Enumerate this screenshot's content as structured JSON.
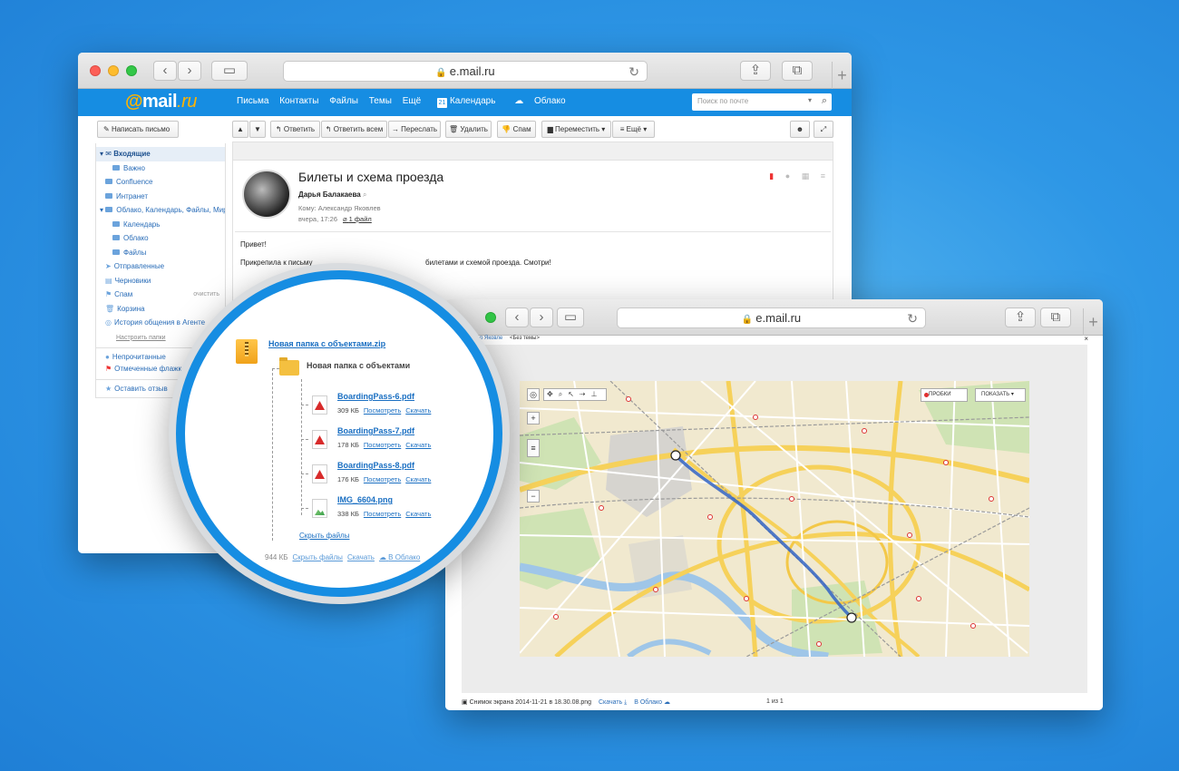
{
  "mail_window": {
    "url": "e.mail.ru",
    "logo": {
      "at": "@",
      "name": "mail",
      "tld": ".ru"
    },
    "nav": [
      "Письма",
      "Контакты",
      "Файлы",
      "Темы",
      "Ещё"
    ],
    "calendar": {
      "day": "21",
      "label": "Календарь"
    },
    "cloud_label": "Облако",
    "search_placeholder": "Поиск по почте",
    "compose_label": "Написать письмо",
    "folders": [
      {
        "label": "Входящие",
        "active": true
      },
      {
        "label": "Важно"
      },
      {
        "label": "Confluence"
      },
      {
        "label": "Интранет"
      },
      {
        "label": "Облако, Календарь, Файлы, Мир"
      },
      {
        "label": "Календарь"
      },
      {
        "label": "Облако"
      },
      {
        "label": "Файлы"
      },
      {
        "label": "Отправленные"
      },
      {
        "label": "Черновики"
      },
      {
        "label": "Спам",
        "extra": "очистить"
      },
      {
        "label": "Корзина"
      },
      {
        "label": "История общения в Агенте"
      },
      {
        "label": "Настроить папки"
      },
      {
        "label": "Непрочитанные"
      },
      {
        "label": "Отмеченные флажком"
      },
      {
        "label": "Оставить отзыв"
      }
    ],
    "toolbar": {
      "reply": "Ответить",
      "reply_all": "Ответить всем",
      "forward": "Переслать",
      "delete": "Удалить",
      "spam": "Спам",
      "move": "Переместить",
      "more": "Ещё"
    },
    "message": {
      "subject": "Билеты и схема проезда",
      "sender": "Дарья Балакаева",
      "to": "Кому: Александр Яковлев",
      "date": "вчера, 17:26",
      "attachments": "1 файл",
      "greeting": "Привет!",
      "body_start": "Прикрепила к письму",
      "body_end": "билетами и схемой проезда. Смотри!"
    }
  },
  "magnifier": {
    "archive_name": "Новая папка с объектами.zip",
    "folder_name": "Новая папка с объектами",
    "files": [
      {
        "name": "BoardingPass-6.pdf",
        "size": "309 КБ",
        "type": "pdf"
      },
      {
        "name": "BoardingPass-7.pdf",
        "size": "178 КБ",
        "type": "pdf"
      },
      {
        "name": "BoardingPass-8.pdf",
        "size": "176 КБ",
        "type": "pdf"
      },
      {
        "name": "IMG_6604.png",
        "size": "338 КБ",
        "type": "png"
      }
    ],
    "view_label": "Посмотреть",
    "download_label": "Скачать",
    "hide_files": "Скрыть файлы",
    "total_size": "944 КБ",
    "to_cloud": "В Облако"
  },
  "viewer_window": {
    "url": "e.mail.ru",
    "header_link": "р Яковле",
    "header_subject": "<Без темы>",
    "map": {
      "traffic_label": "ПРОБКИ",
      "show_label": "ПОКАЗАТЬ"
    },
    "footer": {
      "filename": "Снимок экрана 2014-11-21 в 18.30.08.png",
      "download": "Скачать",
      "to_cloud": "В Облако",
      "pager": "1 из 1"
    }
  }
}
